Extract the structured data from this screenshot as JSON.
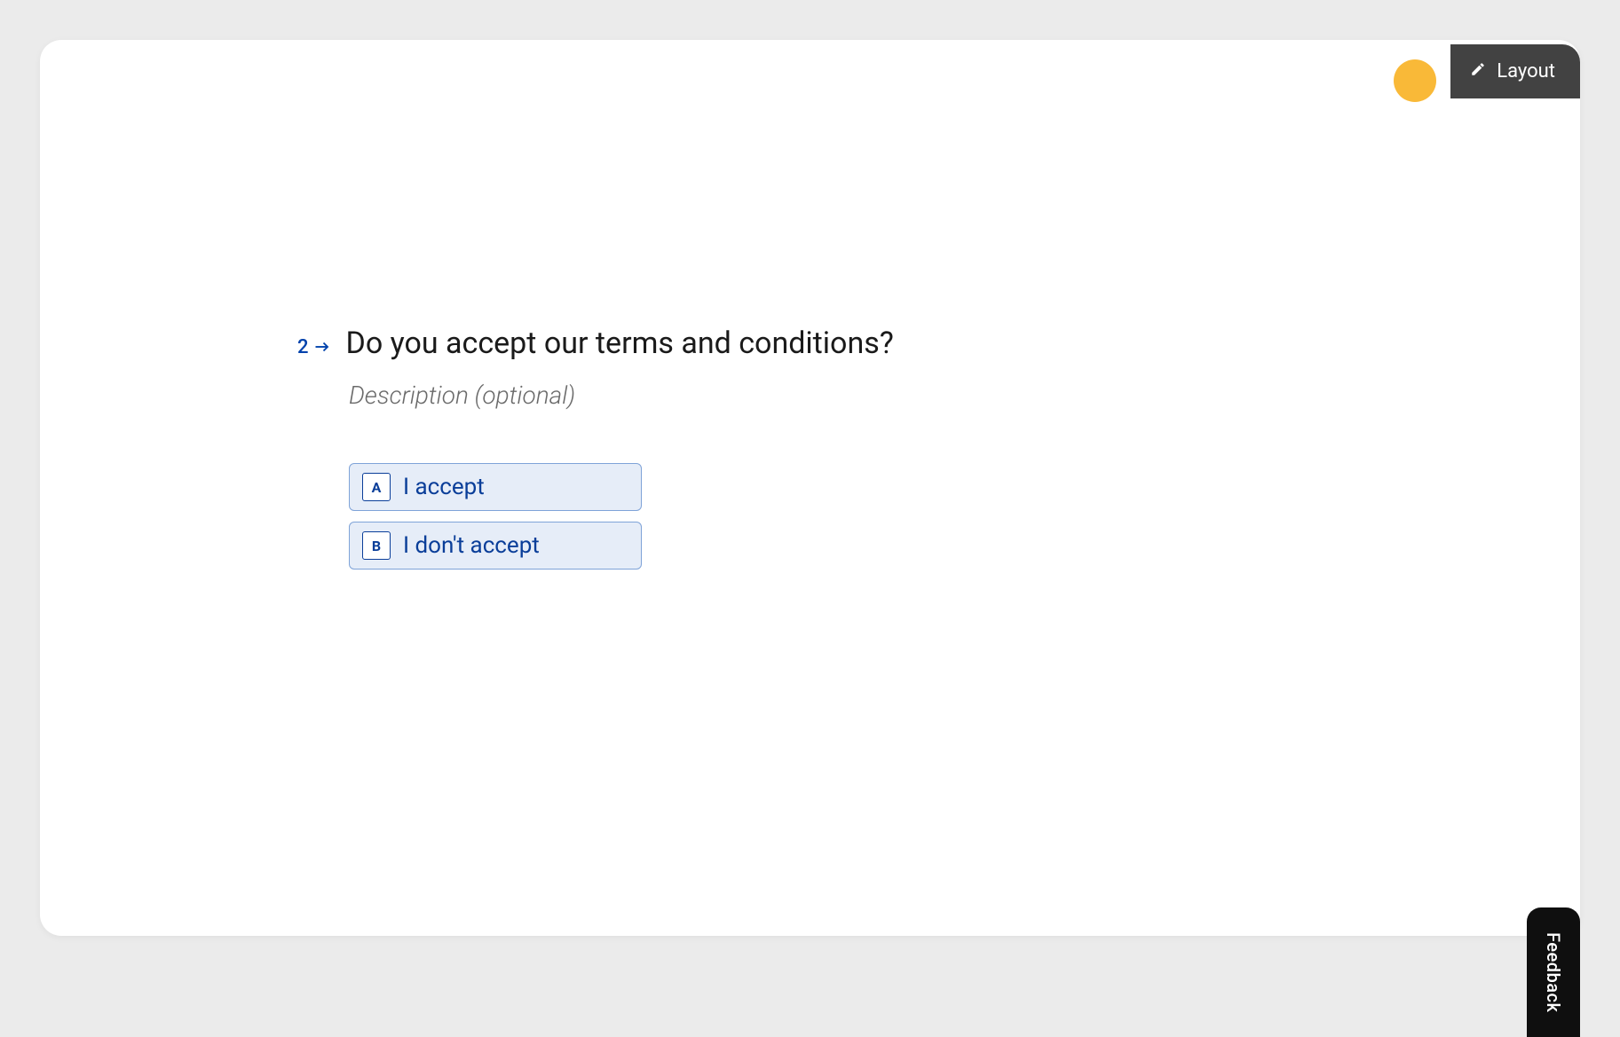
{
  "header": {
    "layout_button_label": "Layout"
  },
  "question": {
    "number": "2",
    "title": "Do you accept our terms and conditions?",
    "description_placeholder": "Description (optional)",
    "options": [
      {
        "key": "A",
        "label": "I accept"
      },
      {
        "key": "B",
        "label": "I don't accept"
      }
    ]
  },
  "feedback_tab_label": "Feedback",
  "colors": {
    "accent": "#0142ac",
    "option_bg": "#e6edf8",
    "option_border": "#7fa3d8",
    "avatar": "#f9b938"
  }
}
